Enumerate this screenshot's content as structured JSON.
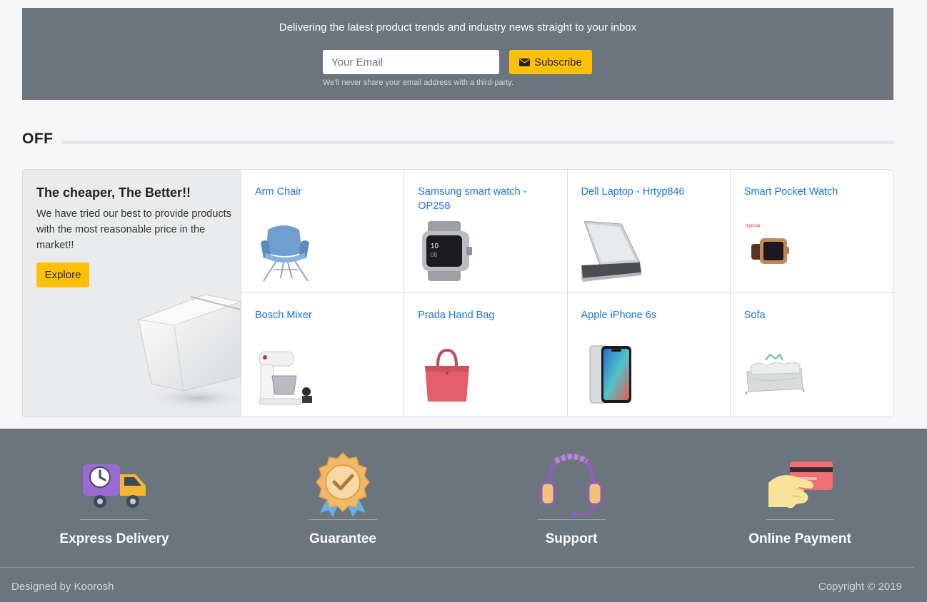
{
  "newsletter": {
    "headline": "Delivering the latest product trends and industry news straight to your inbox",
    "email_placeholder": "Your Email",
    "subscribe_label": "Subscribe",
    "note": "We'll never share your email address with a third-party."
  },
  "section": {
    "title": "OFF"
  },
  "promo": {
    "title": "The cheaper, The Better!!",
    "text": "We have tried our best to provide products with the most reasonable price in the market!!",
    "button_label": "Explore"
  },
  "products": [
    {
      "name": "Arm Chair",
      "icon": "arm-chair-image"
    },
    {
      "name": "Samsung smart watch - OP258",
      "icon": "smart-watch-image"
    },
    {
      "name": "Dell Laptop - Hrtyp846",
      "icon": "laptop-image"
    },
    {
      "name": "Smart Pocket Watch",
      "icon": "pocket-watch-image"
    },
    {
      "name": "Bosch Mixer",
      "icon": "mixer-image"
    },
    {
      "name": "Prada Hand Bag",
      "icon": "hand-bag-image"
    },
    {
      "name": "Apple iPhone 6s",
      "icon": "iphone-image"
    },
    {
      "name": "Sofa",
      "icon": "sofa-image"
    }
  ],
  "features": [
    {
      "label": "Express Delivery",
      "icon": "delivery-truck-icon"
    },
    {
      "label": "Guarantee",
      "icon": "guarantee-badge-icon"
    },
    {
      "label": "Support",
      "icon": "headset-icon"
    },
    {
      "label": "Online Payment",
      "icon": "credit-card-icon"
    }
  ],
  "footer": {
    "designed_by": "Designed by Koorosh",
    "copyright": "Copyright © 2019"
  },
  "colors": {
    "accent": "#ffc107",
    "panel": "#6c757d",
    "link": "#1a73e8"
  }
}
